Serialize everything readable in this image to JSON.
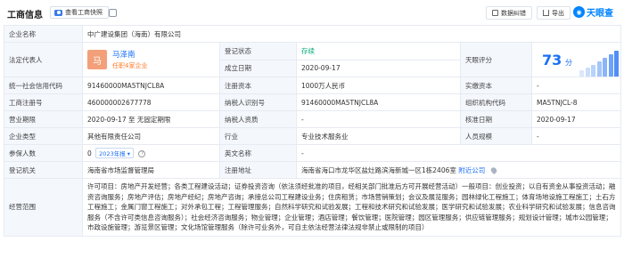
{
  "header": {
    "title": "工商信息",
    "snapshot_label": "查看工商快照",
    "error_label": "数据纠错",
    "export_label": "导出",
    "brand": "天眼查"
  },
  "rows": {
    "company_name": {
      "label": "企业名称",
      "value": "中广建设集团（海南）有限公司"
    },
    "legal_rep": {
      "label": "法定代表人",
      "avatar_char": "马",
      "name": "马泽南",
      "sub": "任职4家企业"
    },
    "reg_status": {
      "label": "登记状态",
      "value": "存续"
    },
    "found_date": {
      "label": "成立日期",
      "value": "2020-09-17"
    },
    "tianyan_score": {
      "label": "天眼评分",
      "value": "73",
      "unit": "分"
    },
    "credit_code": {
      "label": "统一社会信用代码",
      "value": "91460000MA5TNJCL8A"
    },
    "reg_capital": {
      "label": "注册资本",
      "value": "1000万人民币"
    },
    "paid_capital": {
      "label": "实缴资本",
      "value": "-"
    },
    "reg_number": {
      "label": "工商注册号",
      "value": "460000002677778"
    },
    "tax_id": {
      "label": "纳税人识别号",
      "value": "91460000MA5TNJCL8A"
    },
    "org_code": {
      "label": "组织机构代码",
      "value": "MA5TNJCL-8"
    },
    "term": {
      "label": "营业期限",
      "value": "2020-09-17 至 无固定期限"
    },
    "taxpayer_qual": {
      "label": "纳税人资质",
      "value": "-"
    },
    "approve_date": {
      "label": "核准日期",
      "value": "2020-09-17"
    },
    "company_type": {
      "label": "企业类型",
      "value": "其他有限责任公司"
    },
    "industry": {
      "label": "行业",
      "value": "专业技术服务业"
    },
    "staff_size": {
      "label": "人员规模",
      "value": "-"
    },
    "insured": {
      "label": "参保人数",
      "value": "0",
      "year_tag": "2023年报"
    },
    "en_name": {
      "label": "英文名称",
      "value": "-"
    },
    "reg_authority": {
      "label": "登记机关",
      "value": "海南省市场监督管理局"
    },
    "reg_address": {
      "label": "注册地址",
      "value": "海南省海口市龙华区盐灶路滨海新城一区1栋2406室",
      "link": "附近公司"
    },
    "scope": {
      "label": "经营范围",
      "value": "许可项目：房地产开发经营；各类工程建设活动；证券投资咨询（依法须经批准的项目，经相关部门批准后方可开展经营活动）一般项目：创业投资；以自有资金从事投资活动；融资咨询服务；房地产评估；房地产经纪；房地产咨询；承接总公司工程建设业务；住房租赁；市场营销策划；会议及展览服务；园林绿化工程施工；体育场地设施工程施工；土石方工程施工；金属门窗工程施工；对外承包工程；工程管理服务；自然科学研究和试验发展；工程和技术研究和试验发展；医学研究和试验发展；农业科学研究和试验发展；信息咨询服务（不含许可类信息咨询服务）；社会经济咨询服务；物业管理；企业管理；酒店管理；餐饮管理；医院管理；园区管理服务；供应链管理服务；规划设计管理；城市公园管理；市政设施管理；游览景区管理；文化场馆管理服务（除许可业务外，可自主依法经营法律法规非禁止或限制的项目）"
    }
  },
  "colors": {
    "accent": "#1a6ff5",
    "status_green": "#00a878",
    "orange": "#ff7a29",
    "label_bg": "#f4f7fc"
  }
}
